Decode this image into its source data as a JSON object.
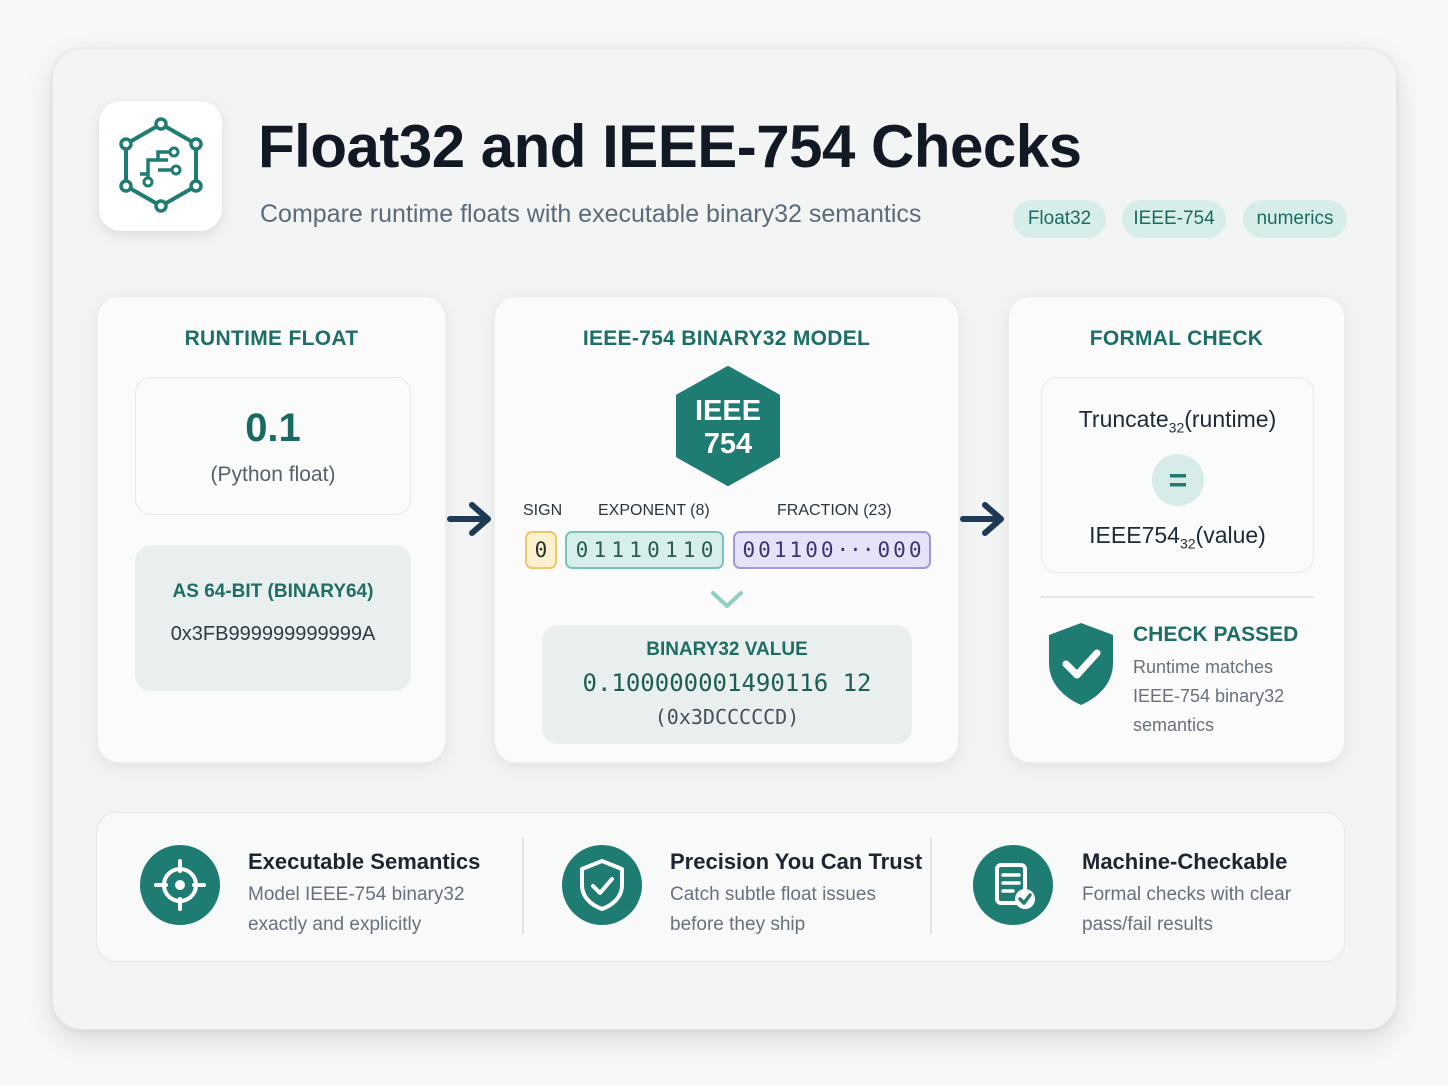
{
  "header": {
    "title": "Float32 and IEEE-754 Checks",
    "subtitle": "Compare runtime floats with executable binary32 semantics",
    "tags": [
      "Float32",
      "IEEE-754",
      "numerics"
    ]
  },
  "runtime_panel": {
    "heading": "RUNTIME FLOAT",
    "value": "0.1",
    "value_note": "(Python float)",
    "binary64_label": "AS 64-BIT (BINARY64)",
    "binary64_hex": "0x3FB999999999999A"
  },
  "model_panel": {
    "heading": "IEEE-754 BINARY32 MODEL",
    "badge_line1": "IEEE",
    "badge_line2": "754",
    "sign_label": "SIGN",
    "exponent_label": "EXPONENT (8)",
    "fraction_label": "FRACTION (23)",
    "sign_bits": [
      "0"
    ],
    "exponent_bits": [
      "0",
      "1",
      "1",
      "1",
      "0",
      "1",
      "1",
      "0"
    ],
    "fraction_bits": [
      "0",
      "0",
      "1",
      "1",
      "0",
      "0",
      "···",
      "0",
      "0",
      "0"
    ],
    "value_label": "BINARY32 VALUE",
    "value": "0.100000001490116 12",
    "value_hex": "(0x3DCCCCCD)"
  },
  "formal_panel": {
    "heading": "FORMAL CHECK",
    "lhs_name": "Truncate",
    "lhs_sub": "32",
    "lhs_arg": "(runtime)",
    "equals": "=",
    "rhs_name": "IEEE754",
    "rhs_sub": "32",
    "rhs_arg": "(value)",
    "result_title": "CHECK PASSED",
    "result_desc": "Runtime matches IEEE-754 binary32 semantics"
  },
  "features": [
    {
      "icon": "target-icon",
      "title": "Executable Semantics",
      "desc_line1": "Model IEEE-754 binary32",
      "desc_line2": "exactly and explicitly"
    },
    {
      "icon": "shield-check-icon",
      "title": "Precision You Can Trust",
      "desc_line1": "Catch subtle float issues",
      "desc_line2": "before they ship"
    },
    {
      "icon": "document-check-icon",
      "title": "Machine-Checkable",
      "desc_line1": "Formal checks with clear",
      "desc_line2": "pass/fail results"
    }
  ],
  "colors": {
    "accent": "#1e7c73",
    "heading": "#1d6e66",
    "arrow": "#1f3a55",
    "sign": "#e9c96a",
    "exponent": "#7cc3b7",
    "fraction": "#a497dd"
  }
}
